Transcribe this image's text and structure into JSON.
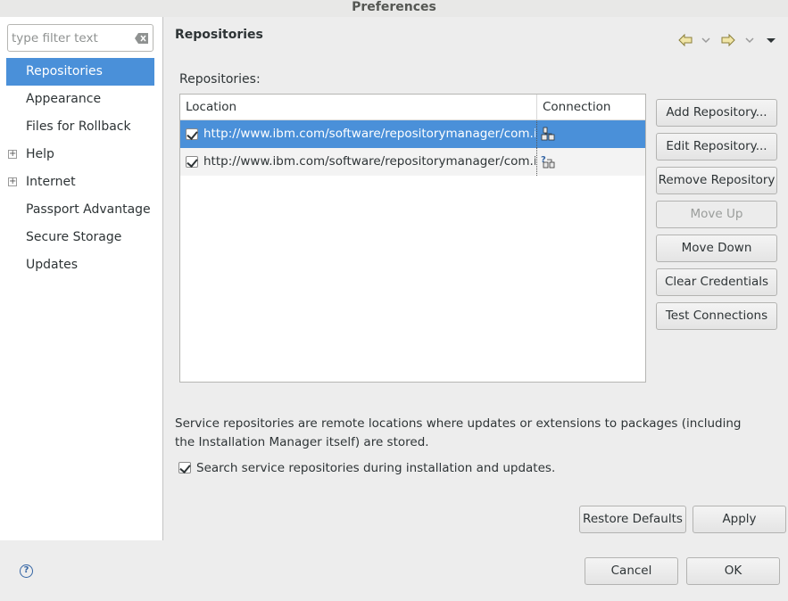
{
  "window": {
    "title": "Preferences"
  },
  "filter": {
    "placeholder": "type filter text"
  },
  "sidebar": {
    "items": [
      {
        "label": "Repositories",
        "selected": true,
        "expandable": false
      },
      {
        "label": "Appearance",
        "selected": false,
        "expandable": false
      },
      {
        "label": "Files for Rollback",
        "selected": false,
        "expandable": false
      },
      {
        "label": "Help",
        "selected": false,
        "expandable": true
      },
      {
        "label": "Internet",
        "selected": false,
        "expandable": true
      },
      {
        "label": "Passport Advantage",
        "selected": false,
        "expandable": false
      },
      {
        "label": "Secure Storage",
        "selected": false,
        "expandable": false
      },
      {
        "label": "Updates",
        "selected": false,
        "expandable": false
      }
    ]
  },
  "page": {
    "title": "Repositories",
    "section_label": "Repositories:"
  },
  "table": {
    "columns": [
      "Location",
      "Connection"
    ],
    "rows": [
      {
        "checked": true,
        "location": "http://www.ibm.com/software/repositorymanager/com.ibm.cic.agent",
        "connection_icon": "connected-icon",
        "selected": true
      },
      {
        "checked": true,
        "location": "http://www.ibm.com/software/repositorymanager/com.ibm.cic.agent",
        "connection_icon": "unknown-connection-icon",
        "selected": false
      }
    ]
  },
  "actions": {
    "add": "Add Repository...",
    "edit": "Edit Repository...",
    "remove": "Remove Repository",
    "move_up": "Move Up",
    "move_down": "Move Down",
    "clear_credentials": "Clear Credentials",
    "test_connections": "Test Connections"
  },
  "description": "Service repositories are remote locations where updates or extensions to packages (including the Installation Manager itself) are stored.",
  "search_service": {
    "label": "Search service repositories during installation and updates.",
    "checked": true
  },
  "buttons": {
    "restore_defaults": "Restore Defaults",
    "apply": "Apply",
    "cancel": "Cancel",
    "ok": "OK"
  },
  "colors": {
    "selection": "#4a90d9",
    "help": "#3465a4"
  }
}
